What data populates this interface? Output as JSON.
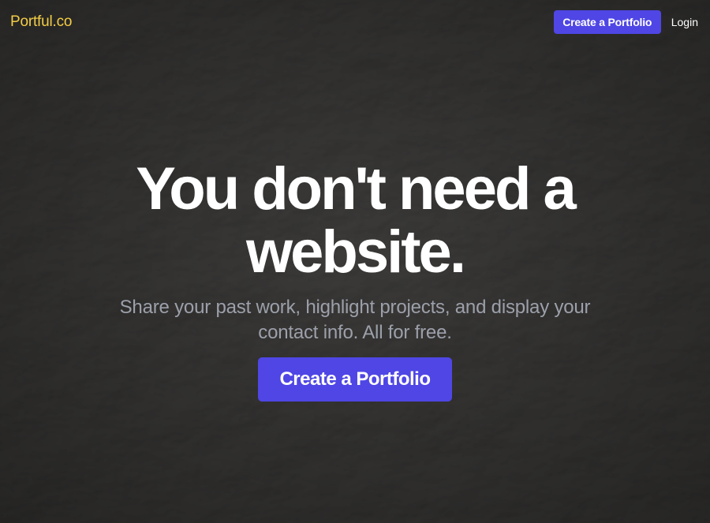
{
  "brand": {
    "logo_text": "Portful.co",
    "logo_color": "#f3cd45",
    "accent_color": "#4f46e5",
    "background_color": "#302f2d"
  },
  "nav": {
    "create_label": "Create a Portfolio",
    "login_label": "Login"
  },
  "hero": {
    "title": "You don't need a website.",
    "subtitle": "Share your past work, highlight projects, and display your contact info. All for free.",
    "cta_label": "Create a Portfolio"
  },
  "background": {
    "texture": "crumpled-paper"
  }
}
